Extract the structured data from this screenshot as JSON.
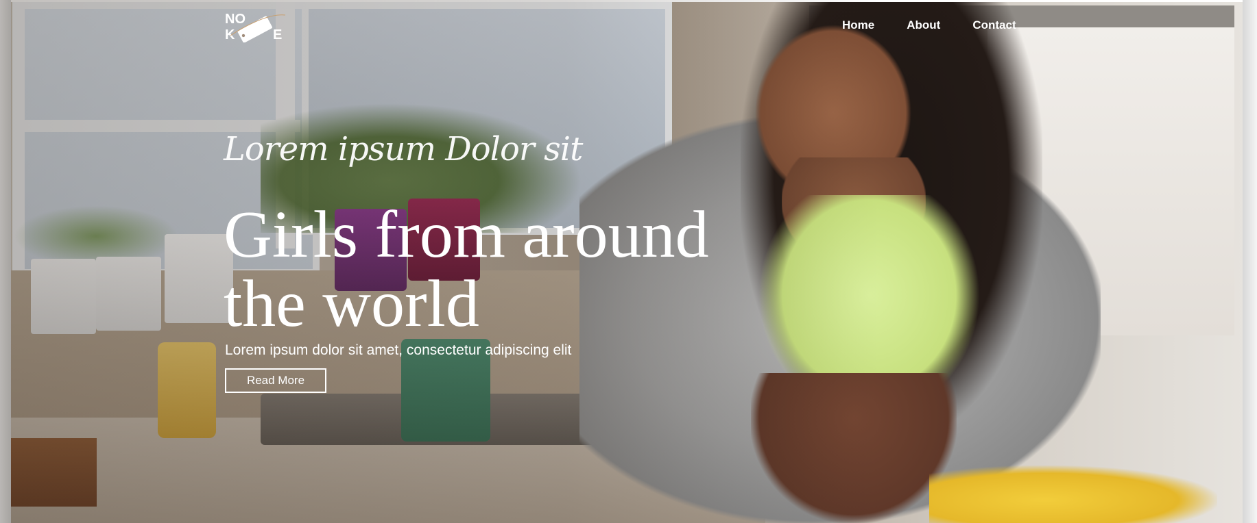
{
  "brand": {
    "logo_text_top": "NO",
    "logo_text_bottom": "K",
    "logo_text_bottom_right": "E",
    "logo_icon": "tag-logo"
  },
  "nav": {
    "items": [
      {
        "label": "Home"
      },
      {
        "label": "About"
      },
      {
        "label": "Contact"
      }
    ]
  },
  "hero": {
    "tagline": "Lorem ipsum Dolor sit",
    "headline": "Girls from around the world",
    "subtext": "Lorem ipsum dolor sit amet, consectetur adipiscing elit",
    "cta_label": "Read More",
    "background_image": "woman-cooking-in-kitchen-photo"
  },
  "colors": {
    "text": "#ffffff",
    "accent": "#ffffff"
  }
}
